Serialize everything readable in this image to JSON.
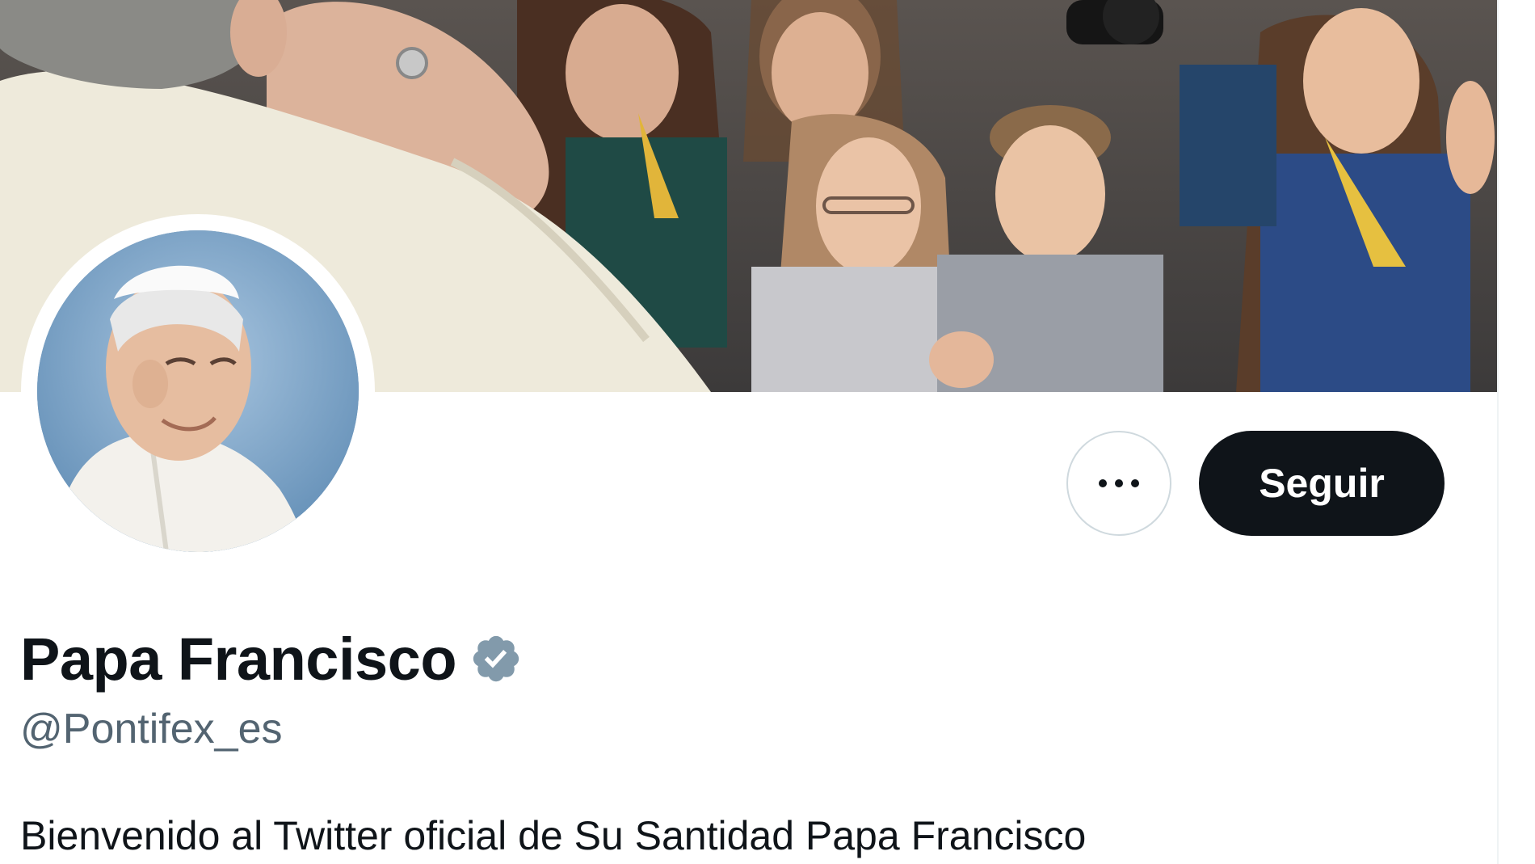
{
  "profile": {
    "display_name": "Papa Francisco",
    "handle": "@Pontifex_es",
    "bio": "Bienvenido al Twitter oficial de Su Santidad Papa Francisco",
    "verified_badge_color": "#829aab"
  },
  "actions": {
    "follow_label": "Seguir",
    "more_icon": "more-horizontal-icon"
  },
  "colors": {
    "primary_text": "#0f1419",
    "secondary_text": "#536471",
    "button_bg": "#0f1419",
    "button_text": "#ffffff",
    "border": "#cfd9de"
  }
}
